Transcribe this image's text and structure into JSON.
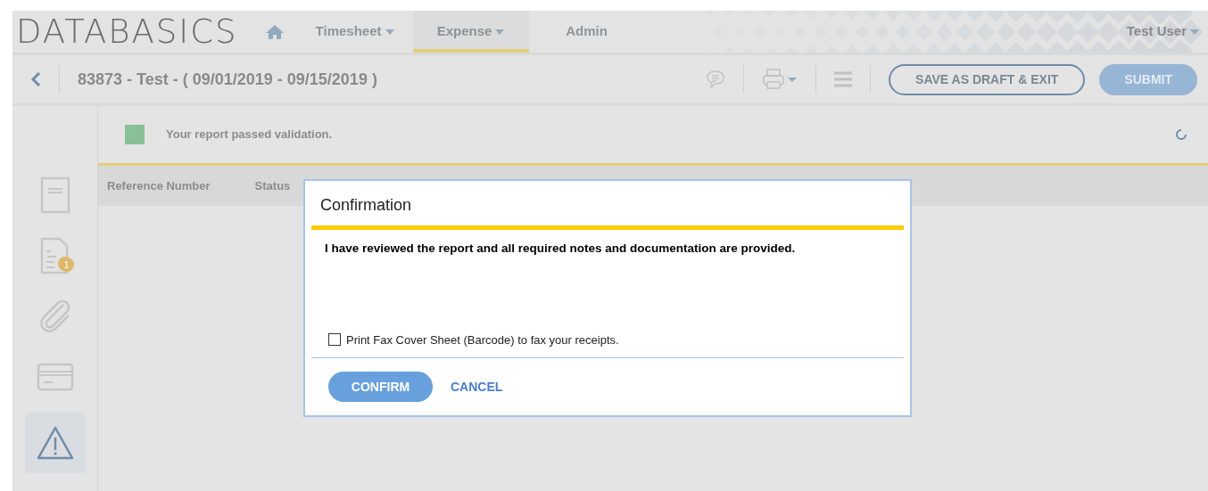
{
  "header": {
    "logo": "DATABASICS",
    "tabs": [
      {
        "label": "Timesheet",
        "dropdown": true,
        "selected": false
      },
      {
        "label": "Expense",
        "dropdown": true,
        "selected": true
      },
      {
        "label": "Admin",
        "dropdown": false,
        "selected": false
      }
    ],
    "user": "Test User"
  },
  "toolbar": {
    "title": "83873 - Test - ( 09/01/2019 - 09/15/2019 )",
    "buttons": [
      {
        "label": "SAVE AS DRAFT & EXIT",
        "kind": "outline"
      },
      {
        "label": "SUBMIT",
        "kind": "primary"
      }
    ]
  },
  "validation": {
    "message": "Your report passed validation."
  },
  "sidebar": {
    "items": [
      {
        "kind": "document",
        "selected": false
      },
      {
        "kind": "receipt",
        "badge": "1",
        "selected": false
      },
      {
        "kind": "attachment",
        "selected": false
      },
      {
        "kind": "card",
        "selected": false
      },
      {
        "kind": "warning",
        "selected": true
      }
    ]
  },
  "table": {
    "columns": [
      "Reference Number",
      "Status"
    ]
  },
  "dialog": {
    "title": "Confirmation",
    "message": "I have reviewed the report and all required notes and documentation are provided.",
    "checkbox": {
      "label": "Print Fax Cover Sheet (Barcode) to fax your receipts.",
      "checked": false
    },
    "buttons": [
      {
        "label": "CONFIRM",
        "kind": "primary"
      },
      {
        "label": "CANCEL",
        "kind": "link"
      }
    ]
  }
}
